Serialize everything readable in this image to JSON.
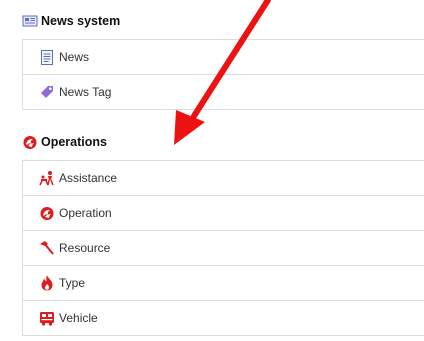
{
  "sections": [
    {
      "title": "News system",
      "icon": "newspaper-icon",
      "items": [
        {
          "label": "News",
          "icon": "document-icon"
        },
        {
          "label": "News Tag",
          "icon": "tag-icon"
        }
      ]
    },
    {
      "title": "Operations",
      "icon": "operations-flame-icon",
      "items": [
        {
          "label": "Assistance",
          "icon": "assistance-icon"
        },
        {
          "label": "Operation",
          "icon": "operation-flame-icon"
        },
        {
          "label": "Resource",
          "icon": "axe-icon"
        },
        {
          "label": "Type",
          "icon": "fire-icon"
        },
        {
          "label": "Vehicle",
          "icon": "fire-truck-icon"
        }
      ]
    }
  ],
  "colors": {
    "accent_red": "#e01b1b",
    "news_icon_blue": "#5a6fbf",
    "tag_purple": "#8a6dd6",
    "annotation_arrow": "#ee1111"
  },
  "annotation": {
    "type": "arrow",
    "color": "#ee1111"
  }
}
